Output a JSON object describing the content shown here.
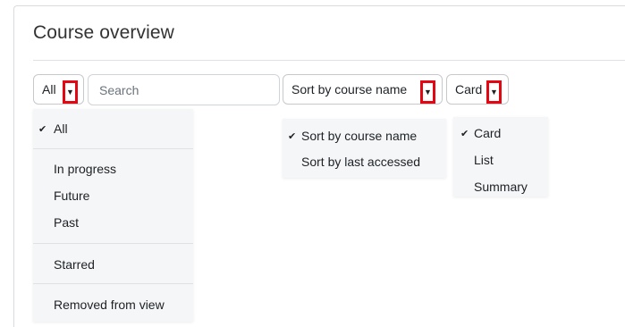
{
  "block": {
    "title": "Course overview"
  },
  "filter": {
    "selected": "All",
    "caret_icon": "chevron-down-icon",
    "options": [
      "All",
      "In progress",
      "Future",
      "Past",
      "Starred",
      "Removed from view"
    ]
  },
  "search": {
    "placeholder": "Search",
    "value": ""
  },
  "sort": {
    "selected": "Sort by course name",
    "options": [
      "Sort by course name",
      "Sort by last accessed"
    ]
  },
  "view": {
    "selected": "Card",
    "options": [
      "Card",
      "List",
      "Summary"
    ]
  },
  "check_glyph": "✔",
  "colors": {
    "highlight_border": "#e30613",
    "menu_bg": "#f5f6f7"
  }
}
